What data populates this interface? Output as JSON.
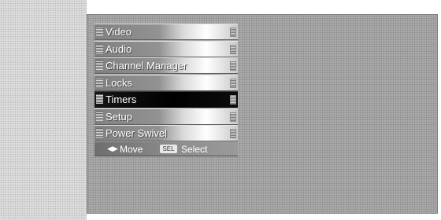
{
  "menu": {
    "items": [
      {
        "label": "Video",
        "selected": false
      },
      {
        "label": "Audio",
        "selected": false
      },
      {
        "label": "Channel Manager",
        "selected": false
      },
      {
        "label": "Locks",
        "selected": false
      },
      {
        "label": "Timers",
        "selected": true
      },
      {
        "label": "Setup",
        "selected": false
      },
      {
        "label": "Power Swivel",
        "selected": false
      }
    ]
  },
  "hint_bar": {
    "move_icon": "move-arrows-icon",
    "move_label": "Move",
    "select_key": "SEL",
    "select_label": "Select"
  }
}
